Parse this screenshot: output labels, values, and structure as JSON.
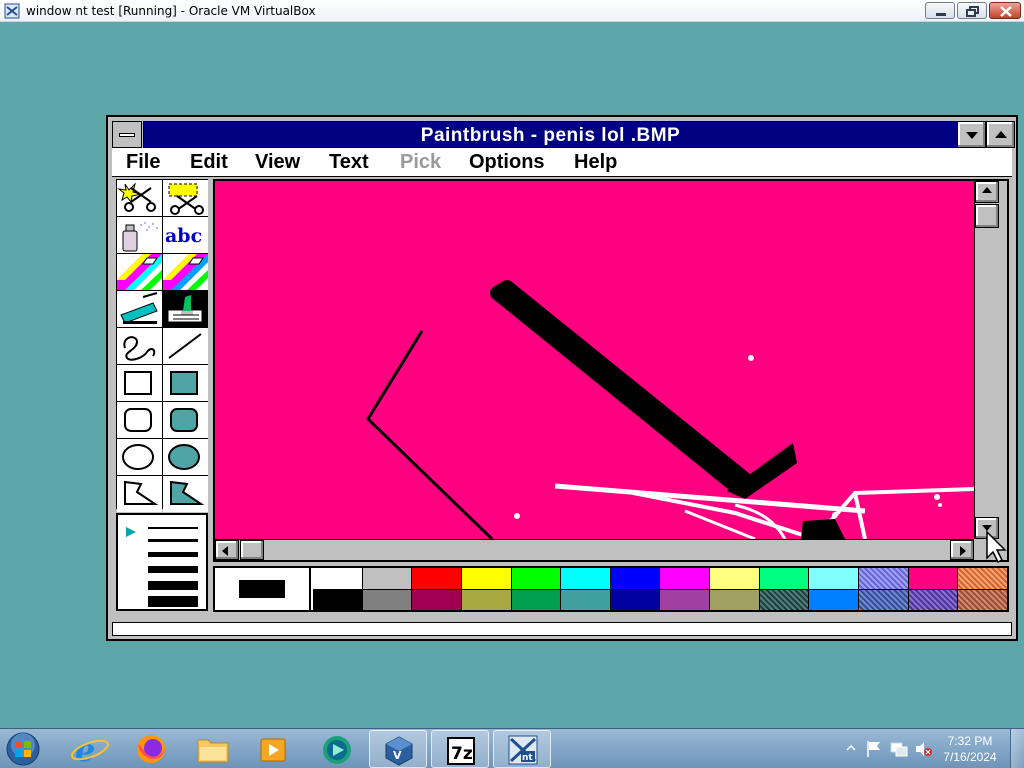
{
  "host_window": {
    "title": "window nt test [Running] - Oracle VM VirtualBox",
    "buttons": [
      "minimize",
      "maximize",
      "close"
    ]
  },
  "paintbrush": {
    "title": "Paintbrush - penis lol .BMP",
    "menu": [
      {
        "label": "File",
        "enabled": true
      },
      {
        "label": "Edit",
        "enabled": true
      },
      {
        "label": "View",
        "enabled": true
      },
      {
        "label": "Text",
        "enabled": true
      },
      {
        "label": "Pick",
        "enabled": false
      },
      {
        "label": "Options",
        "enabled": true
      },
      {
        "label": "Help",
        "enabled": true
      }
    ],
    "tools": [
      {
        "name": "scissors-tool-icon"
      },
      {
        "name": "pick-tool-icon"
      },
      {
        "name": "airbrush-tool-icon"
      },
      {
        "name": "text-tool-icon",
        "label": "abc"
      },
      {
        "name": "color-eraser-tool-icon"
      },
      {
        "name": "eraser-tool-icon"
      },
      {
        "name": "paint-roller-tool-icon"
      },
      {
        "name": "brush-tool-icon",
        "selected": true
      },
      {
        "name": "curve-tool-icon"
      },
      {
        "name": "line-tool-icon"
      },
      {
        "name": "box-tool-icon"
      },
      {
        "name": "filled-box-tool-icon"
      },
      {
        "name": "rounded-box-tool-icon"
      },
      {
        "name": "filled-rounded-box-tool-icon"
      },
      {
        "name": "circle-tool-icon"
      },
      {
        "name": "filled-circle-tool-icon"
      },
      {
        "name": "polygon-tool-icon"
      },
      {
        "name": "filled-polygon-tool-icon"
      }
    ],
    "line_sizes": 6,
    "canvas_color": "#ff0080",
    "foreground_color": "#000000",
    "background_color": "#ffffff",
    "palette": {
      "top": [
        "#ffffff",
        "#c0c0c0",
        "#ff0000",
        "#ffff00",
        "#00ff00",
        "#00ffff",
        "#0000ff",
        "#ff00ff",
        "#ffff80",
        "#00ff80",
        "#80ffff",
        "#8080ff",
        "#ff0080",
        "#ff8040"
      ],
      "bottom": [
        "#000000",
        "#808080",
        "#a0004f",
        "#a8a840",
        "#00a050",
        "#40a0a0",
        "#0000a0",
        "#a040a0",
        "#a0a060",
        "#205050",
        "#0080ff",
        "#4060c0",
        "#6040c0",
        "#c06040"
      ]
    }
  },
  "taskbar": {
    "apps": [
      "start-orb",
      "internet-explorer-icon",
      "firefox-icon",
      "file-explorer-icon",
      "media-player-icon",
      "app-icon",
      "virtualbox-icon",
      "7zip-icon",
      "windows-nt-vm-icon"
    ],
    "clock_time": "7:32 PM",
    "clock_date": "7/16/2024",
    "accent": "#6d94b9"
  }
}
